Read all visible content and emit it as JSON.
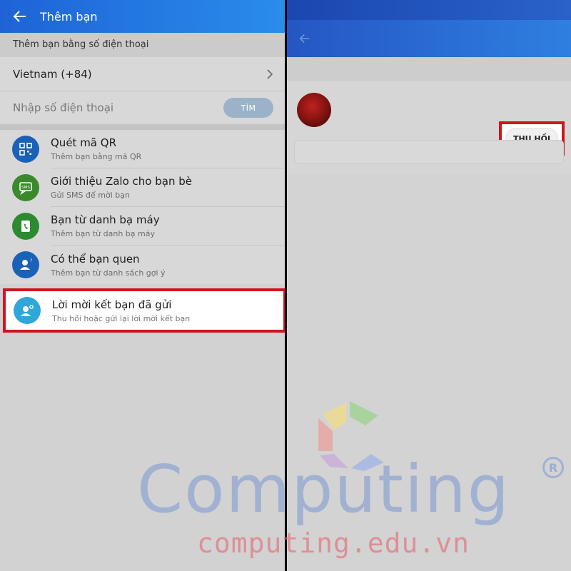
{
  "left": {
    "header": {
      "title": "Thêm bạn"
    },
    "phone_section_title": "Thêm bạn bằng số điện thoại",
    "country": "Vietnam (+84)",
    "phone_placeholder": "Nhập số điện thoại",
    "search_button": "TÌM",
    "items": [
      {
        "label": "Quét mã QR",
        "sub": "Thêm bạn bằng mã QR",
        "icon": "qr-code-icon",
        "color": "#1a61b8"
      },
      {
        "label": "Giới thiệu Zalo cho bạn bè",
        "sub": "Gửi SMS để mời bạn",
        "icon": "sms-icon",
        "color": "#3a8a2c"
      },
      {
        "label": "Bạn từ danh bạ máy",
        "sub": "Thêm bạn từ danh bạ máy",
        "icon": "contacts-phone-icon",
        "color": "#2e8a30"
      },
      {
        "label": "Có thể bạn quen",
        "sub": "Thêm bạn từ danh sách gợi ý",
        "icon": "person-suggest-icon",
        "color": "#1a61b8"
      }
    ],
    "highlighted_item": {
      "label": "Lời mời kết bạn đã gửi",
      "sub": "Thu hồi hoặc gửi lại lời mời kết bạn",
      "icon": "person-settings-icon",
      "color": "#30a7d8"
    }
  },
  "right": {
    "revoke_button": "THU HỒI"
  },
  "watermark": {
    "brand": "Computing",
    "site": "computing.edu.vn",
    "registered": "R"
  },
  "colors": {
    "header_blue": "#1e63d6",
    "highlight_red": "#d0161c"
  }
}
